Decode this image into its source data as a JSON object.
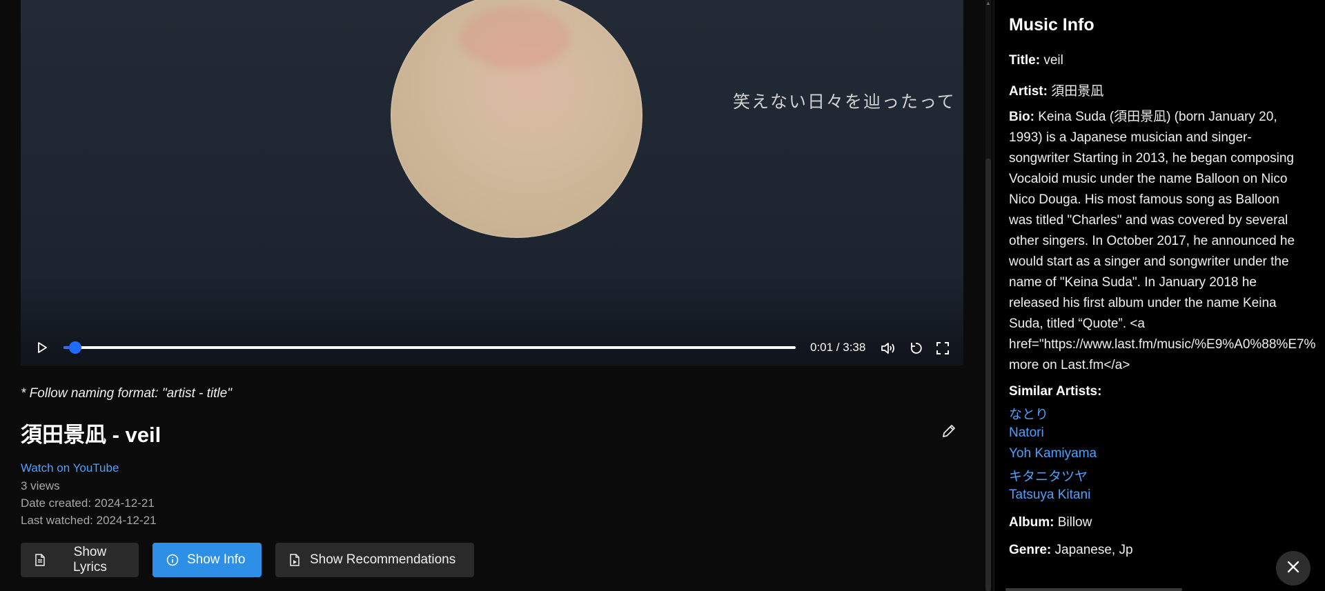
{
  "player": {
    "caption": "笑えない日々を辿ったって",
    "time": "0:01 / 3:38",
    "progress_fraction": 0.005
  },
  "main": {
    "naming_note": "* Follow naming format: \"artist - title\"",
    "title": "須田景凪 - veil",
    "youtube_link": "Watch on YouTube",
    "views": "3 views",
    "date_created": "Date created: 2024-12-21",
    "last_watched": "Last watched: 2024-12-21",
    "buttons": {
      "lyrics": "Show Lyrics",
      "info": "Show Info",
      "recommendations": "Show Recommendations"
    }
  },
  "info_panel": {
    "heading": "Music Info",
    "title_label": "Title:",
    "title_value": "veil",
    "artist_label": "Artist:",
    "artist_value": "須田景凪",
    "bio_label": "Bio:",
    "bio_lines": [
      "Keina Suda (須田景凪) (born January 20,",
      "1993) is a Japanese musician and singer-",
      "songwriter Starting in 2013, he began composing",
      "Vocaloid music under the name Balloon on Nico",
      "Nico Douga. His most famous song as Balloon",
      "was titled \"Charles\" and was covered by several",
      "other singers. In October 2017, he announced he",
      "would start as a singer and songwriter under the",
      "name of \"Keina Suda\". In January 2018 he",
      "released his first album under the name Keina",
      "Suda, titled “Quote”. <a",
      "href=\"https://www.last.fm/music/%E9%A0%88%E7%",
      "more on Last.fm</a>"
    ],
    "similar_label": "Similar Artists:",
    "similar_artists": [
      "なとり",
      "Natori",
      "Yoh Kamiyama",
      "キタニタツヤ",
      "Tatsuya Kitani"
    ],
    "album_label": "Album:",
    "album_value": "Billow",
    "genre_label": "Genre:",
    "genre_value": "Japanese, Jp"
  },
  "colors": {
    "accent": "#2e8fe6",
    "link": "#4ea1ff",
    "progress": "#1f6bff"
  }
}
